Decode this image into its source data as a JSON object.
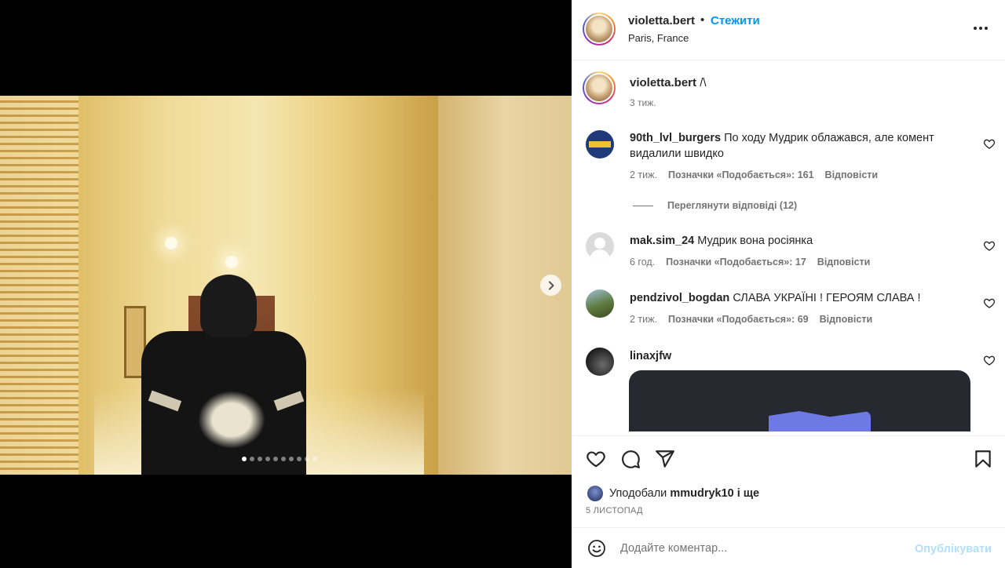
{
  "post": {
    "author": "violetta.bert",
    "follow_label": "Стежити",
    "separator": "•",
    "location": "Paris, France",
    "caption": "/\\",
    "caption_time": "3 тиж.",
    "slide_count": 10,
    "active_slide": 1
  },
  "comments": [
    {
      "user": "90th_lvl_burgers",
      "text": "По ходу Мудрик облажався, але комент видалили швидко",
      "time": "2 тиж.",
      "likes": "Позначки «Подобається»: 161",
      "reply": "Відповісти",
      "view_replies": "Переглянути відповіді (12)",
      "avatar_color": "#1f3a7a"
    },
    {
      "user": "mak.sim_24",
      "text": "Мудрик вона росіянка",
      "time": "6 год.",
      "likes": "Позначки «Подобається»: 17",
      "reply": "Відповісти",
      "avatar_color": "#d9d9d9"
    },
    {
      "user": "pendzivol_bogdan",
      "text": "СЛАВА УКРАЇНІ ! ГЕРОЯМ СЛАВА !",
      "time": "2 тиж.",
      "likes": "Позначки «Подобається»: 69",
      "reply": "Відповісти",
      "avatar_color": "#4f6b3a"
    },
    {
      "user": "linaxjfw",
      "text": "",
      "avatar_color": "#1e1e1e"
    }
  ],
  "actions": {
    "liked_by_prefix": "Уподобали",
    "liked_by_user": "mmudryk10",
    "liked_by_suffix": "і ще",
    "date": "5 ЛИСТОПАД"
  },
  "composer": {
    "placeholder": "Додайте коментар...",
    "publish_label": "Опублікувати"
  },
  "icons": [
    "chevron-right-icon",
    "more-icon",
    "heart-icon",
    "comment-icon",
    "share-icon",
    "bookmark-icon",
    "emoji-icon"
  ]
}
